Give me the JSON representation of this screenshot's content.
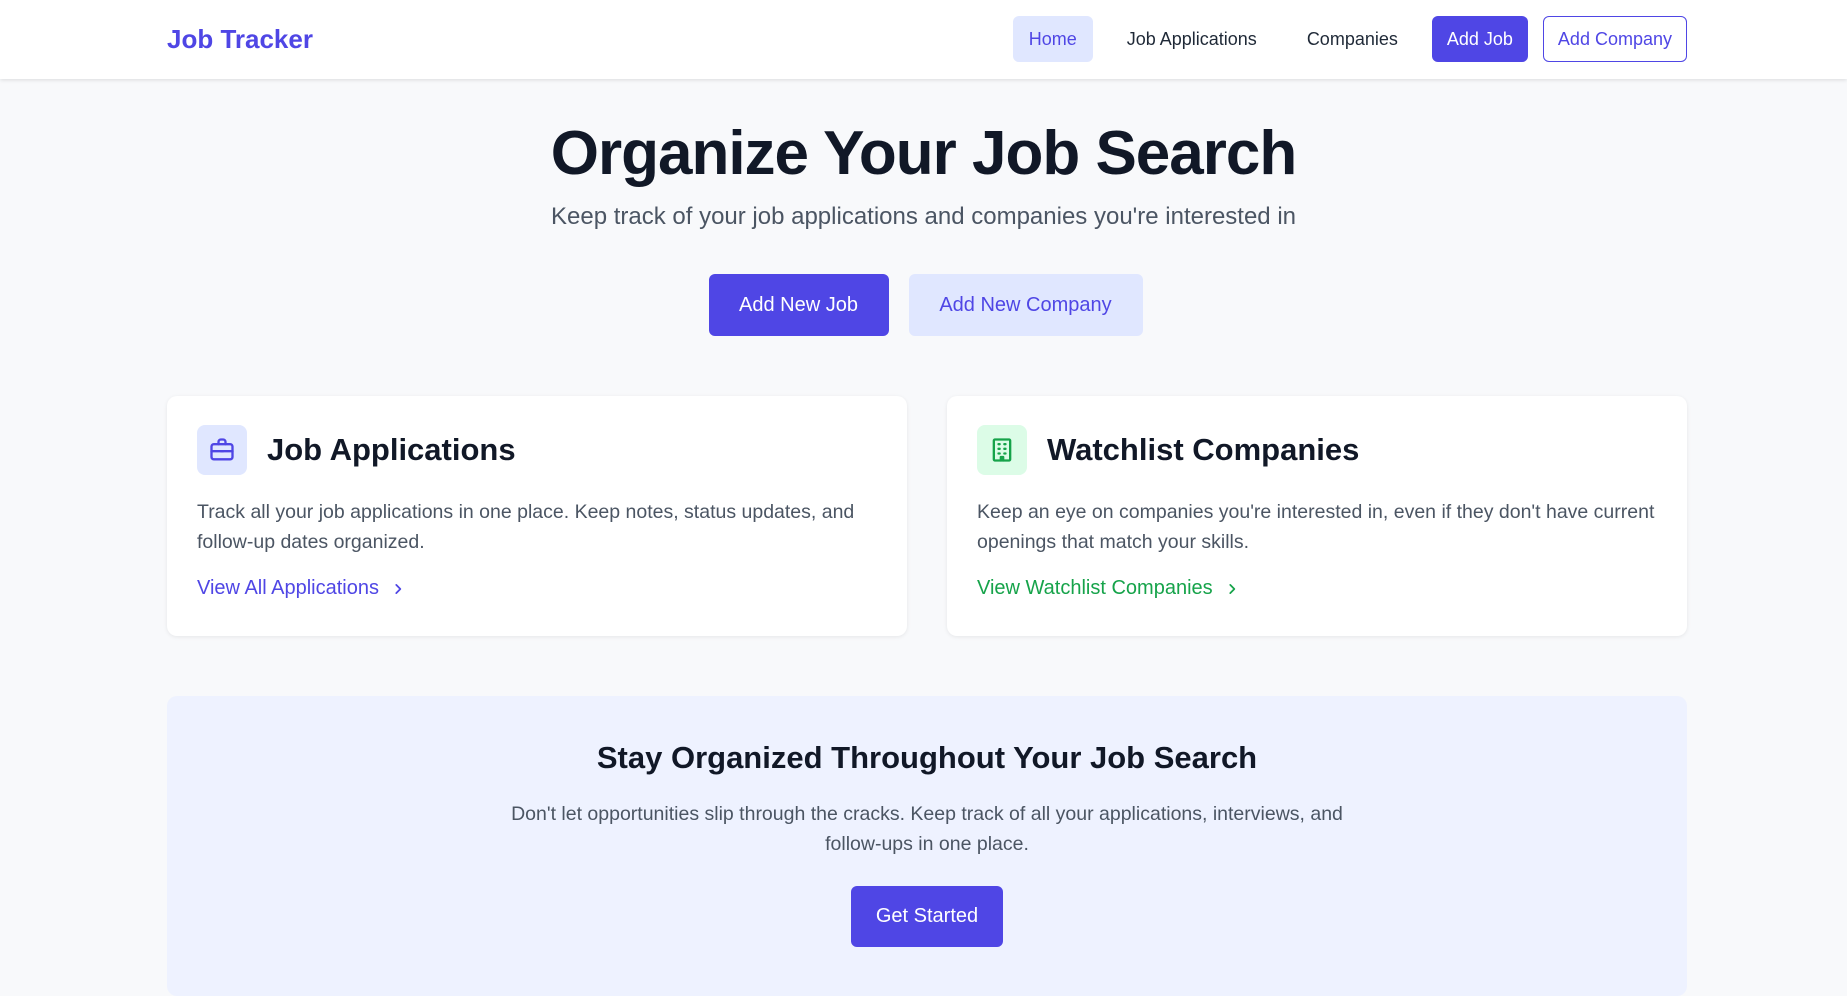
{
  "colors": {
    "accent": "#4f46e5",
    "accent_light": "#e0e7ff",
    "green": "#16a34a",
    "green_light": "#dcfce7",
    "background": "#f8f9fb",
    "cta_background": "#eef2ff"
  },
  "navbar": {
    "brand": "Job Tracker",
    "links": {
      "home": "Home",
      "job_applications": "Job Applications",
      "companies": "Companies"
    },
    "add_job": "Add Job",
    "add_company": "Add Company",
    "active_link": "home"
  },
  "hero": {
    "title": "Organize Your Job Search",
    "subtitle": "Keep track of your job applications and companies you're interested in",
    "primary_button": "Add New Job",
    "secondary_button": "Add New Company"
  },
  "cards": {
    "applications": {
      "icon": "briefcase-icon",
      "title": "Job Applications",
      "description": "Track all your job applications in one place. Keep notes, status updates, and follow-up dates organized.",
      "link": "View All Applications"
    },
    "watchlist": {
      "icon": "building-icon",
      "title": "Watchlist Companies",
      "description": "Keep an eye on companies you're interested in, even if they don't have current openings that match your skills.",
      "link": "View Watchlist Companies"
    }
  },
  "cta": {
    "title": "Stay Organized Throughout Your Job Search",
    "text": "Don't let opportunities slip through the cracks. Keep track of all your applications, interviews, and follow-ups in one place.",
    "button": "Get Started"
  }
}
